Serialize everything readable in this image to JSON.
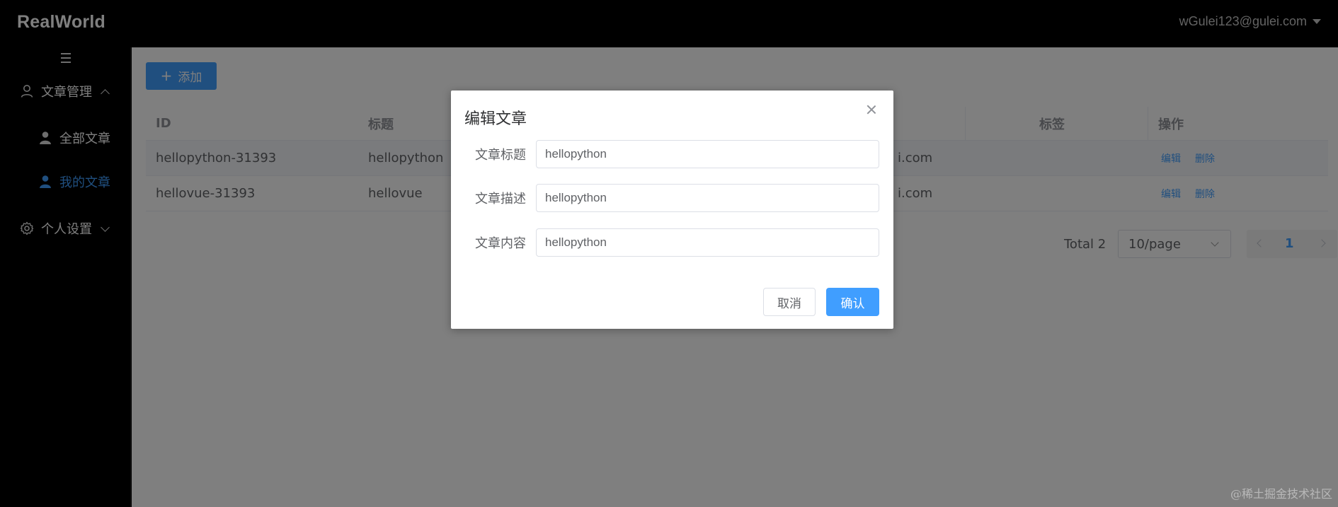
{
  "header": {
    "brand": "RealWorld",
    "user_email": "wGulei123@gulei.com"
  },
  "sidebar": {
    "items": [
      {
        "label": "文章管理",
        "icon": "user-icon",
        "expanded": true
      },
      {
        "label": "全部文章",
        "icon": "user-filled-icon"
      },
      {
        "label": "我的文章",
        "icon": "user-filled-icon",
        "active": true
      },
      {
        "label": "个人设置",
        "icon": "gear-icon",
        "expanded": false
      }
    ]
  },
  "toolbar": {
    "add_label": "添加"
  },
  "table": {
    "columns": [
      "ID",
      "标题",
      "标签",
      "操作"
    ],
    "rows": [
      {
        "id": "hellopython-31393",
        "title": "hellopython",
        "email_fragment": "i.com"
      },
      {
        "id": "hellovue-31393",
        "title": "hellovue",
        "email_fragment": "i.com"
      }
    ],
    "edit_label": "编辑",
    "delete_label": "删除"
  },
  "pagination": {
    "total": "Total 2",
    "page_size": "10/page",
    "current_page": "1"
  },
  "dialog": {
    "title": "编辑文章",
    "fields": [
      {
        "label": "文章标题",
        "value": "hellopython"
      },
      {
        "label": "文章描述",
        "value": "hellopython"
      },
      {
        "label": "文章内容",
        "value": "hellopython"
      }
    ],
    "cancel_label": "取消",
    "confirm_label": "确认"
  },
  "watermark": "@稀土掘金技术社区",
  "colors": {
    "primary": "#409eff",
    "header_bg": "#000000",
    "overlay": "rgba(0,0,0,0.5)"
  }
}
